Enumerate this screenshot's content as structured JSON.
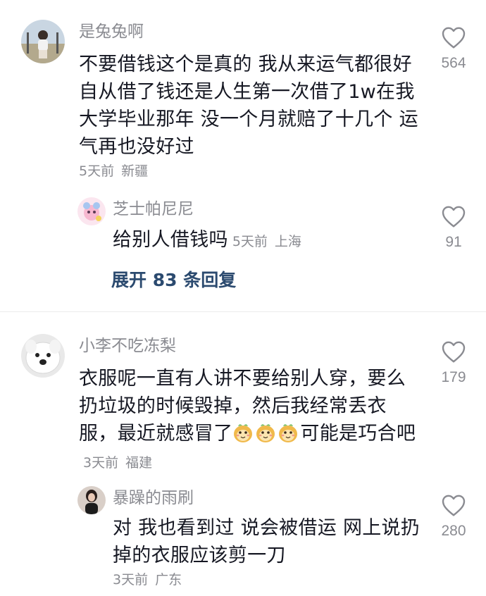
{
  "comments": [
    {
      "username": "是兔兔啊",
      "content": "不要借钱这个是真的 我从来运气都很好 自从借了钱还是人生第一次借了1w在我大学毕业那年 没一个月就赔了十几个 运气再也没好过",
      "time": "5天前",
      "location": "新疆",
      "likes": "564",
      "reply": {
        "username": "芝士帕尼尼",
        "content": "给别人借钱吗",
        "time": "5天前",
        "location": "上海",
        "likes": "91"
      },
      "expand_label": "展开 83 条回复"
    },
    {
      "username": "小李不吃冻梨",
      "content_before_emoji": "衣服呢一直有人讲不要给别人穿，要么扔垃圾的时候毁掉，然后我经常丢衣服，最近就感冒了",
      "emoji_count": 3,
      "emoji_icon": "smiling-face-emoji",
      "content_after_emoji": "可能是巧合吧",
      "time": "3天前",
      "location": "福建",
      "likes": "179",
      "reply": {
        "username": "暴躁的雨刷",
        "content": "对 我也看到过 说会被借运 网上说扔掉的衣服应该剪一刀",
        "time": "3天前",
        "location": "广东",
        "likes": "280"
      }
    }
  ],
  "colors": {
    "text": "#161823",
    "secondary": "#8a8b91",
    "link": "#2b4a6f",
    "divider": "#ececec"
  },
  "icons": [
    "heart-outline-icon",
    "smiling-face-emoji"
  ]
}
